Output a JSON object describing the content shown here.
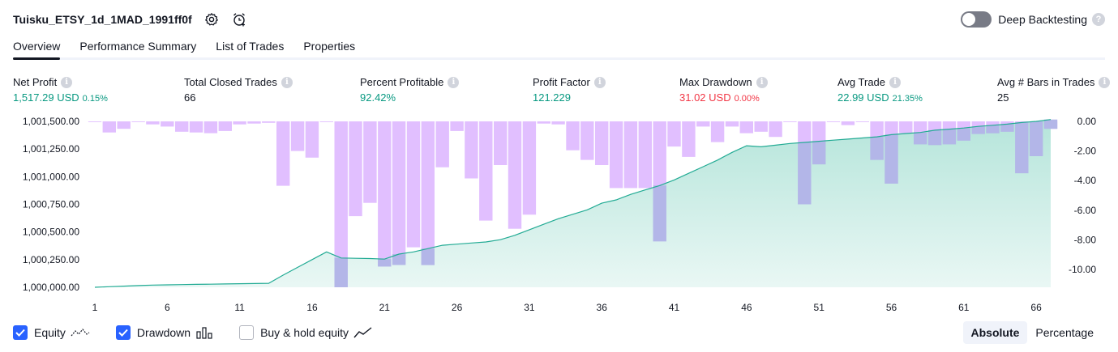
{
  "header": {
    "title": "Tuisku_ETSY_1d_1MAD_1991ff0f",
    "deep_backtesting_label": "Deep Backtesting",
    "deep_backtesting_enabled": false,
    "help_glyph": "?"
  },
  "tabs": [
    {
      "label": "Overview",
      "active": true
    },
    {
      "label": "Performance Summary",
      "active": false
    },
    {
      "label": "List of Trades",
      "active": false
    },
    {
      "label": "Properties",
      "active": false
    }
  ],
  "metrics": {
    "net_profit": {
      "label": "Net Profit",
      "value": "1,517.29 USD",
      "pct": "0.15%"
    },
    "total_closed_trades": {
      "label": "Total Closed Trades",
      "value": "66"
    },
    "percent_profitable": {
      "label": "Percent Profitable",
      "value": "92.42%"
    },
    "profit_factor": {
      "label": "Profit Factor",
      "value": "121.229"
    },
    "max_drawdown": {
      "label": "Max Drawdown",
      "value": "31.02 USD",
      "pct": "0.00%"
    },
    "avg_trade": {
      "label": "Avg Trade",
      "value": "22.99 USD",
      "pct": "21.35%"
    },
    "avg_bars": {
      "label": "Avg # Bars in Trades",
      "value": "25"
    },
    "info_glyph": "i"
  },
  "legend": {
    "equity_label": "Equity",
    "drawdown_label": "Drawdown",
    "buyhold_label": "Buy & hold equity",
    "equity_checked": true,
    "drawdown_checked": true,
    "buyhold_checked": false
  },
  "view_toggle": {
    "absolute_label": "Absolute",
    "percentage_label": "Percentage",
    "selected": "Absolute"
  },
  "colors": {
    "equity_line": "#22ab94",
    "equity_fill_top": "#a8e0d4",
    "drawdown_bar": "#e1bfff",
    "drawdown_bar_overlap": "#b3b6e8",
    "profit": "#089981",
    "loss": "#f23645",
    "accent": "#2962ff"
  },
  "chart_data": {
    "type": "area",
    "x": [
      1,
      2,
      3,
      4,
      5,
      6,
      7,
      8,
      9,
      10,
      11,
      12,
      13,
      14,
      15,
      16,
      17,
      18,
      19,
      20,
      21,
      22,
      23,
      24,
      25,
      26,
      27,
      28,
      29,
      30,
      31,
      32,
      33,
      34,
      35,
      36,
      37,
      38,
      39,
      40,
      41,
      42,
      43,
      44,
      45,
      46,
      47,
      48,
      49,
      50,
      51,
      52,
      53,
      54,
      55,
      56,
      57,
      58,
      59,
      60,
      61,
      62,
      63,
      64,
      65,
      66,
      67
    ],
    "x_ticks": [
      "1",
      "6",
      "11",
      "16",
      "21",
      "26",
      "31",
      "36",
      "41",
      "46",
      "51",
      "56",
      "61",
      "66"
    ],
    "left_axis": {
      "ticks": [
        "1,000,000.00",
        "1,000,250.00",
        "1,000,500.00",
        "1,000,750.00",
        "1,001,000.00",
        "1,001,250.00",
        "1,001,500.00"
      ],
      "ylim": [
        1000000,
        1001500
      ]
    },
    "right_axis": {
      "ticks": [
        "0.00",
        "-2.00",
        "-4.00",
        "-6.00",
        "-8.00",
        "-10.00"
      ],
      "ylim": [
        -11.2,
        0
      ]
    },
    "series": [
      {
        "name": "Equity",
        "axis": "left",
        "values": [
          1000000,
          1000005,
          1000010,
          1000015,
          1000020,
          1000022,
          1000024,
          1000026,
          1000028,
          1000030,
          1000032,
          1000034,
          1000036,
          1000110,
          1000180,
          1000250,
          1000320,
          1000265,
          1000262,
          1000260,
          1000255,
          1000300,
          1000320,
          1000350,
          1000380,
          1000390,
          1000400,
          1000410,
          1000430,
          1000470,
          1000520,
          1000570,
          1000620,
          1000660,
          1000700,
          1000760,
          1000790,
          1000840,
          1000880,
          1000920,
          1000970,
          1001030,
          1001090,
          1001150,
          1001220,
          1001280,
          1001270,
          1001285,
          1001300,
          1001310,
          1001320,
          1001330,
          1001340,
          1001350,
          1001360,
          1001380,
          1001390,
          1001400,
          1001420,
          1001430,
          1001440,
          1001455,
          1001465,
          1001475,
          1001490,
          1001500,
          1001517
        ]
      },
      {
        "name": "Drawdown",
        "axis": "right",
        "values": [
          -0.05,
          -0.75,
          -0.5,
          -0.05,
          -0.2,
          -0.35,
          -0.7,
          -0.75,
          -0.8,
          -0.65,
          -0.2,
          -0.15,
          -0.1,
          -4.35,
          -2.0,
          -2.45,
          -0.05,
          -11.2,
          -6.4,
          -5.5,
          -9.8,
          -9.7,
          -8.5,
          -9.7,
          -3.1,
          -0.65,
          -3.85,
          -6.7,
          -2.95,
          -7.25,
          -6.3,
          -0.15,
          -0.2,
          -1.95,
          -2.6,
          -2.95,
          -4.5,
          -4.5,
          -4.5,
          -8.1,
          -1.7,
          -2.4,
          -0.35,
          -1.4,
          -0.35,
          -0.8,
          -0.7,
          -1.05,
          -0.05,
          -5.6,
          -2.9,
          -0.05,
          -0.25,
          -0.05,
          -2.6,
          -4.2,
          -0.8,
          -1.55,
          -1.6,
          -1.55,
          -1.3,
          -0.85,
          -0.8,
          -0.7,
          -3.5,
          -2.35,
          -0.5
        ]
      }
    ]
  }
}
